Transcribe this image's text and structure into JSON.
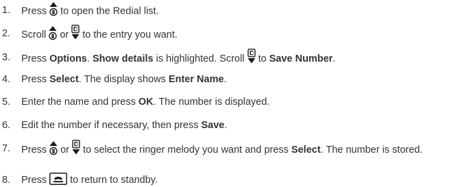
{
  "steps": [
    {
      "number": "1.",
      "parts": [
        {
          "t": "Press "
        },
        {
          "icon": "redial-up-icon"
        },
        {
          "t": " to open the Redial list."
        }
      ]
    },
    {
      "number": "2.",
      "parts": [
        {
          "t": "Scroll "
        },
        {
          "icon": "redial-up-icon"
        },
        {
          "t": " or "
        },
        {
          "icon": "calls-down-icon"
        },
        {
          "t": " to the entry you want."
        }
      ]
    },
    {
      "number": "3.",
      "parts": [
        {
          "t": "Press "
        },
        {
          "t": "Options",
          "bold": true
        },
        {
          "t": ". "
        },
        {
          "t": "Show details",
          "bold": true
        },
        {
          "t": " is highlighted. Scroll "
        },
        {
          "icon": "calls-down-icon"
        },
        {
          "t": " to "
        },
        {
          "t": "Save Number",
          "bold": true
        },
        {
          "t": "."
        }
      ]
    },
    {
      "number": "4.",
      "parts": [
        {
          "t": "Press "
        },
        {
          "t": "Select",
          "bold": true
        },
        {
          "t": ". The display shows "
        },
        {
          "t": "Enter Name",
          "bold": true
        },
        {
          "t": "."
        }
      ]
    },
    {
      "number": "5.",
      "parts": [
        {
          "t": "Enter the name and press "
        },
        {
          "t": "OK",
          "bold": true
        },
        {
          "t": ". The number is displayed."
        }
      ]
    },
    {
      "number": "6.",
      "parts": [
        {
          "t": "Edit the number if necessary, then press "
        },
        {
          "t": "Save",
          "bold": true
        },
        {
          "t": "."
        }
      ]
    },
    {
      "number": "7.",
      "parts": [
        {
          "t": "Press "
        },
        {
          "icon": "redial-up-icon"
        },
        {
          "t": " or "
        },
        {
          "icon": "calls-down-icon"
        },
        {
          "t": " to select the ringer melody you want and press "
        },
        {
          "t": "Select",
          "bold": true
        },
        {
          "t": ". The number is stored."
        }
      ]
    },
    {
      "number": "8.",
      "parts": [
        {
          "t": "Press "
        },
        {
          "icon": "end-call-icon"
        },
        {
          "t": " to return to standby."
        }
      ]
    }
  ],
  "colors": {
    "text": "#333333",
    "icon": "#1a1a1a"
  }
}
